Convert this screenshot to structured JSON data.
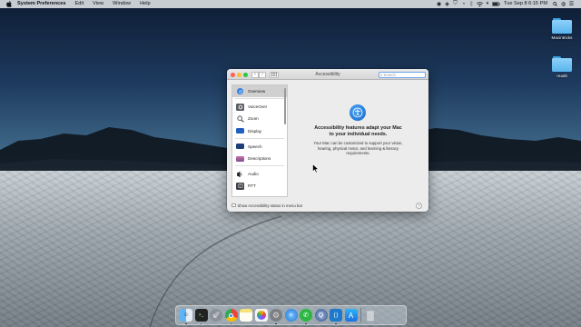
{
  "menubar": {
    "app_name": "System Preferences",
    "items": [
      "Edit",
      "View",
      "Window",
      "Help"
    ],
    "clock": "Tue Sep 8  6:15 PM"
  },
  "desktop": {
    "icons": [
      {
        "label": "Macintricks"
      },
      {
        "label": "readit"
      }
    ]
  },
  "window": {
    "title": "Accessibility",
    "search_placeholder": "Search",
    "sidebar": {
      "items": [
        {
          "label": "Overview",
          "icon": "overview-icon",
          "selected": true
        },
        {
          "label": "VoiceOver",
          "icon": "voiceover-icon"
        },
        {
          "label": "Zoom",
          "icon": "zoom-icon"
        },
        {
          "label": "Display",
          "icon": "display-icon"
        },
        {
          "label": "Speech",
          "icon": "speech-icon"
        },
        {
          "label": "Descriptions",
          "icon": "descriptions-icon"
        },
        {
          "label": "Audio",
          "icon": "audio-icon"
        },
        {
          "label": "RTT",
          "icon": "rtt-icon"
        }
      ]
    },
    "content": {
      "title": "Accessibility features adapt your Mac to your individual needs.",
      "body": "Your Mac can be customized to support your vision, hearing, physical motor, and learning & literacy requirements."
    },
    "bottom": {
      "checkbox_label": "Show Accessibility status in menu bar",
      "checkbox_checked": false,
      "help_label": "?"
    }
  },
  "dock": {
    "apps": [
      {
        "name": "finder-icon",
        "color": "#3b8ee6"
      },
      {
        "name": "terminal-icon",
        "color": "#222222"
      },
      {
        "name": "launchpad-icon",
        "color": "#8a8f99"
      },
      {
        "name": "chrome-icon",
        "color": "#e9453a"
      },
      {
        "name": "notes-icon",
        "color": "#f7e27a"
      },
      {
        "name": "photos-icon",
        "color": "#f0f0f0"
      },
      {
        "name": "system-preferences-icon",
        "color": "#7d7f84"
      },
      {
        "name": "safari-icon",
        "color": "#2a8ff0"
      },
      {
        "name": "whatsapp-icon",
        "color": "#2bb741"
      },
      {
        "name": "quicktime-icon",
        "color": "#3a5c9a"
      },
      {
        "name": "vscode-icon",
        "color": "#1d79c9"
      },
      {
        "name": "app-store-icon",
        "color": "#2a8ff0"
      }
    ],
    "trash": {
      "name": "trash-icon",
      "color": "#c9ced4"
    }
  }
}
